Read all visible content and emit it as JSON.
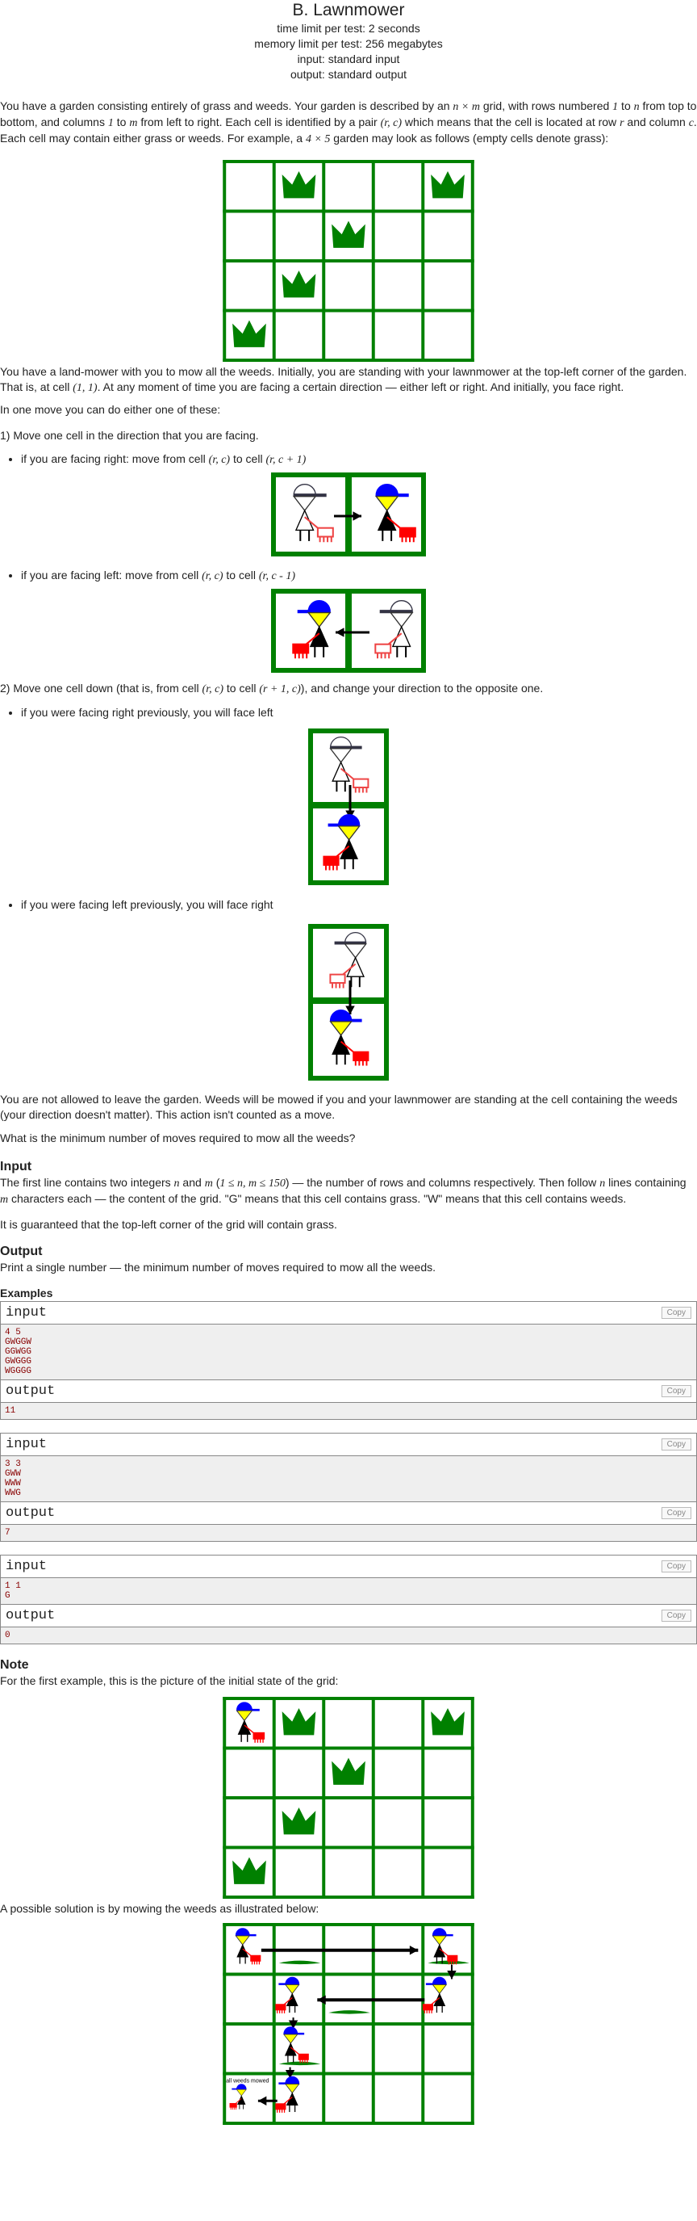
{
  "header": {
    "title": "B. Lawnmower",
    "time_limit": "time limit per test: 2 seconds",
    "memory_limit": "memory limit per test: 256 megabytes",
    "input": "input: standard input",
    "output": "output: standard output"
  },
  "statement": {
    "p1a": "You have a garden consisting entirely of grass and weeds. Your garden is described by an ",
    "p1b": " grid, with rows numbered ",
    "p1c": " to ",
    "p1d": " from top to bottom, and columns ",
    "p1e": " to ",
    "p1f": " from left to right. Each cell is identified by a pair ",
    "p1g": " which means that the cell is located at row ",
    "p1h": " and column ",
    "p1i": ". Each cell may contain either grass or weeds. For example, a ",
    "p1j": " garden may look as follows (empty cells denote grass):",
    "p2a": "You have a land-mower with you to mow all the weeds. Initially, you are standing with your lawnmower at the top-left corner of the garden. That is, at cell ",
    "p2b": ". At any moment of time you are facing a certain direction — either left or right. And initially, you face right.",
    "p3": "In one move you can do either one of these:",
    "p4": "1) Move one cell in the direction that you are facing.",
    "li1a": "if you are facing right: move from cell ",
    "li1b": " to cell ",
    "li2a": "if you are facing left: move from cell ",
    "li2b": " to cell ",
    "p5a": "2) Move one cell down (that is, from cell ",
    "p5b": " to cell ",
    "p5c": "), and change your direction to the opposite one.",
    "li3": "if you were facing right previously, you will face left",
    "li4": "if you were facing left previously, you will face right",
    "p6": "You are not allowed to leave the garden. Weeds will be mowed if you and your lawnmower are standing at the cell containing the weeds (your direction doesn't matter). This action isn't counted as a move.",
    "p7": "What is the minimum number of moves required to mow all the weeds?",
    "math": {
      "nxm": "n × m",
      "one": "1",
      "n": "n",
      "m": "m",
      "rc": "(r, c)",
      "r": "r",
      "c": "c",
      "fourxfive": "4 × 5",
      "oneone": "(1, 1)",
      "rc1": "(r, c + 1)",
      "rcm1": "(r, c - 1)",
      "r1c": "(r + 1, c)"
    }
  },
  "input_section": {
    "title": "Input",
    "p1a": "The first line contains two integers ",
    "p1b": " and ",
    "p1c": " (",
    "p1d": ") — the number of rows and columns respectively. Then follow ",
    "p1e": " lines containing ",
    "p1f": " characters each — the content of the grid. \"G\" means that this cell contains grass. \"W\" means that this cell contains weeds.",
    "p2": "It is guaranteed that the top-left corner of the grid will contain grass.",
    "math": {
      "n": "n",
      "m": "m",
      "range": "1 ≤ n, m ≤ 150"
    }
  },
  "output_section": {
    "title": "Output",
    "p1": "Print a single number — the minimum number of moves required to mow all the weeds."
  },
  "examples": {
    "title": "Examples",
    "input_label": "input",
    "output_label": "output",
    "copy_label": "Copy",
    "tests": [
      {
        "input": "4 5\nGWGGW\nGGWGG\nGWGGG\nWGGGG",
        "output": "11"
      },
      {
        "input": "3 3\nGWW\nWWW\nWWG",
        "output": "7"
      },
      {
        "input": "1 1\nG",
        "output": "0"
      }
    ]
  },
  "note": {
    "title": "Note",
    "p1": "For the first example, this is the picture of the initial state of the grid:",
    "p2": "A possible solution is by mowing the weeds as illustrated below:",
    "annot": "all weeds mowed"
  },
  "grid_example": {
    "rows": 4,
    "cols": 5,
    "weeds": [
      [
        0,
        1
      ],
      [
        0,
        4
      ],
      [
        1,
        2
      ],
      [
        2,
        1
      ],
      [
        3,
        0
      ]
    ]
  },
  "colors": {
    "grass_border": "#008000",
    "weed": "#008000",
    "hat": "#0000ff",
    "mower": "#ff0000"
  }
}
